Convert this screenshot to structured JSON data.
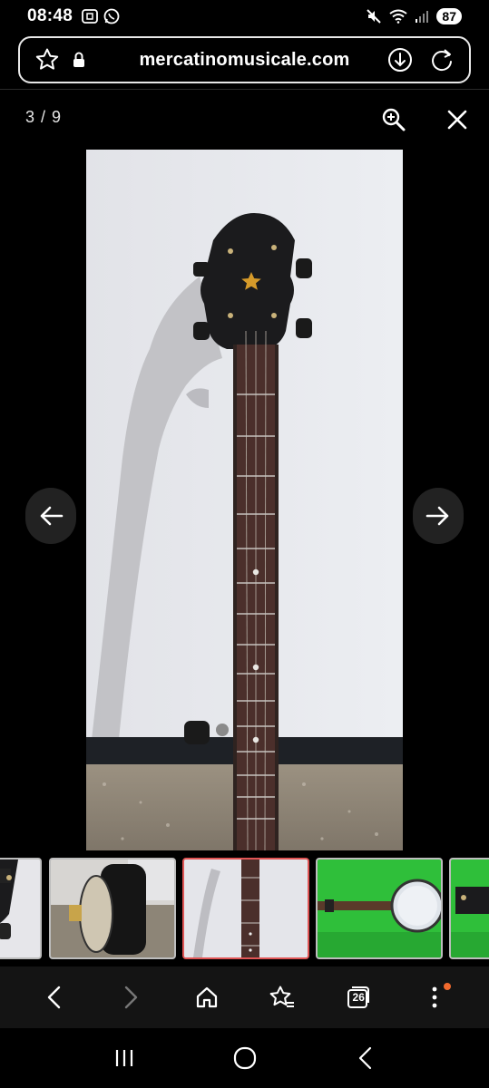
{
  "status_bar": {
    "time": "08:48",
    "battery": "87"
  },
  "url_bar": {
    "url": "mercatinomusicale.com"
  },
  "gallery": {
    "counter": "3 / 9",
    "current_index": 3,
    "total": 9,
    "thumbnails": [
      {
        "id": "thumb-1",
        "desc": "headstock-closeup",
        "active": false
      },
      {
        "id": "thumb-2",
        "desc": "banjo-case",
        "active": false
      },
      {
        "id": "thumb-3",
        "desc": "neck-against-wall",
        "active": true
      },
      {
        "id": "thumb-4",
        "desc": "banjo-on-green",
        "active": false
      },
      {
        "id": "thumb-5",
        "desc": "banjo-on-green-partial",
        "active": false
      }
    ]
  },
  "browser_nav": {
    "tab_count": "26"
  },
  "colors": {
    "background": "#000000",
    "active_thumb_border": "#e05555",
    "notification_dot": "#f26a2e",
    "toolbar_bg": "#141414"
  }
}
